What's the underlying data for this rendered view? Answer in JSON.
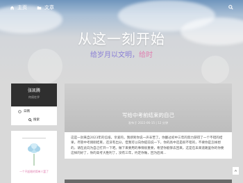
{
  "nav": {
    "items": [
      {
        "label": "主页",
        "icon": "home-icon"
      },
      {
        "label": "文章",
        "icon": "folder-icon"
      }
    ],
    "search_icon": "search-icon"
  },
  "hero": {
    "title": "从这一刻开始",
    "subtitle_main": "给岁月以文明，",
    "subtitle_accent": "给时"
  },
  "profile": {
    "name": "张凯腾",
    "description": "何须在乎",
    "location": "日韩",
    "button_label": "搜索"
  },
  "widget": {
    "caption": "一个不起眼的简单人罢了"
  },
  "post": {
    "title": "写给中考前结束的自己",
    "meta": "发布于 2022-06-15 | 12 分钟",
    "excerpt": "这是一封来自2023年的信纸，亲爱的，我感到你说一声辛苦了。你翻过初中三年的努力获得了一个不错的结果，尽管中考刚刚结束，还没有出分，但我可以向你提前说一下，你的高中还是很不错的，不要你是怎样想的，请在此向为自己打开一下吧。做下来要用的事情很重要，希望你能够去回来，这是在未来道路里你的你要这样的好了，你的高考大胜利了，没有三年，约定你做，回为后阅..."
  },
  "colors": {
    "accent": "#8a7fd6",
    "pink": "#e07fb0",
    "dark": "#2f2f2f"
  }
}
